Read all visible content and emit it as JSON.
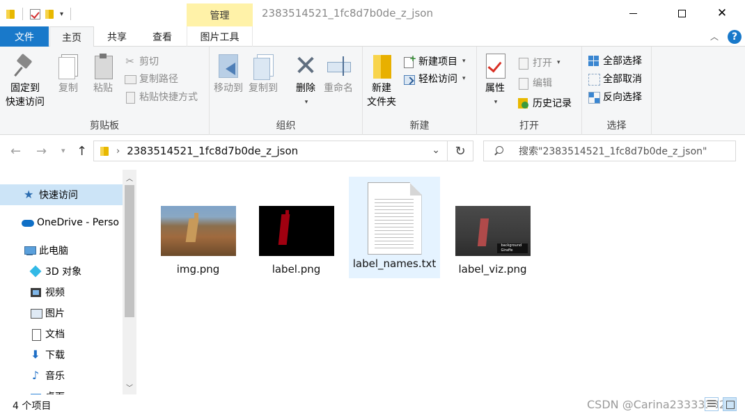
{
  "titlebar": {
    "context_tab": "管理",
    "window_title": "2383514521_1fc8d7b0de_z_json",
    "minimize_label": "—",
    "maximize_label": "☐",
    "close_label": "✕"
  },
  "tabs": {
    "file": "文件",
    "home": "主页",
    "share": "共享",
    "view": "查看",
    "picture_tools": "图片工具"
  },
  "ribbon": {
    "clipboard": {
      "label": "剪贴板",
      "pin_line1": "固定到",
      "pin_line2": "快速访问",
      "copy": "复制",
      "paste": "粘贴",
      "cut": "剪切",
      "copy_path": "复制路径",
      "paste_shortcut": "粘贴快捷方式"
    },
    "organize": {
      "label": "组织",
      "move_to": "移动到",
      "copy_to": "复制到",
      "delete": "删除",
      "rename": "重命名"
    },
    "new": {
      "label": "新建",
      "new_folder_line1": "新建",
      "new_folder_line2": "文件夹",
      "new_item": "新建项目",
      "easy_access": "轻松访问"
    },
    "open": {
      "label": "打开",
      "properties": "属性",
      "open": "打开",
      "edit": "编辑",
      "history": "历史记录"
    },
    "select": {
      "label": "选择",
      "select_all": "全部选择",
      "select_none": "全部取消",
      "invert": "反向选择"
    }
  },
  "address": {
    "path": "2383514521_1fc8d7b0de_z_json",
    "search_placeholder": "搜索\"2383514521_1fc8d7b0de_z_json\""
  },
  "nav": {
    "items": [
      {
        "label": "快速访问",
        "icon": "star-icon"
      },
      {
        "label": "OneDrive - Perso",
        "icon": "onedrive-cloud-icon"
      },
      {
        "label": "此电脑",
        "icon": "this-pc-icon"
      },
      {
        "label": "3D 对象",
        "icon": "3d-objects-icon"
      },
      {
        "label": "视频",
        "icon": "videos-icon"
      },
      {
        "label": "图片",
        "icon": "pictures-icon"
      },
      {
        "label": "文档",
        "icon": "documents-icon"
      },
      {
        "label": "下载",
        "icon": "downloads-icon"
      },
      {
        "label": "音乐",
        "icon": "music-icon"
      },
      {
        "label": "桌面",
        "icon": "desktop-icon"
      }
    ]
  },
  "files": [
    {
      "name": "img.png"
    },
    {
      "name": "label.png"
    },
    {
      "name": "label_names.txt"
    },
    {
      "name": "label_viz.png"
    }
  ],
  "viz_legend": {
    "line1": "background",
    "line2": "Giraffe"
  },
  "status": {
    "item_count": "4 个项目",
    "watermark": "CSDN @Carina23333332"
  },
  "colors": {
    "accent": "#1979ca",
    "context_tab": "#fff2a8",
    "selection": "#cce4f7"
  }
}
